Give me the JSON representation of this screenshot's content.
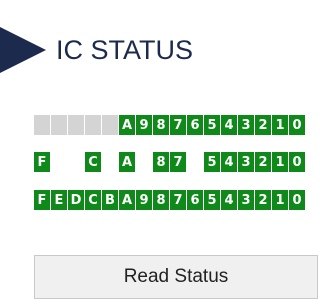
{
  "header": {
    "title": "IC STATUS"
  },
  "rows": [
    {
      "bits": [
        {
          "label": "",
          "state": "off"
        },
        {
          "label": "",
          "state": "off"
        },
        {
          "label": "",
          "state": "off"
        },
        {
          "label": "",
          "state": "off"
        },
        {
          "label": "",
          "state": "off"
        },
        {
          "label": "A",
          "state": "on"
        },
        {
          "label": "9",
          "state": "on"
        },
        {
          "label": "8",
          "state": "on"
        },
        {
          "label": "7",
          "state": "on"
        },
        {
          "label": "6",
          "state": "on"
        },
        {
          "label": "5",
          "state": "on"
        },
        {
          "label": "4",
          "state": "on"
        },
        {
          "label": "3",
          "state": "on"
        },
        {
          "label": "2",
          "state": "on"
        },
        {
          "label": "1",
          "state": "on"
        },
        {
          "label": "0",
          "state": "on"
        }
      ]
    },
    {
      "bits": [
        {
          "label": "F",
          "state": "on"
        },
        {
          "label": "",
          "state": "blank"
        },
        {
          "label": "",
          "state": "blank"
        },
        {
          "label": "C",
          "state": "on"
        },
        {
          "label": "",
          "state": "blank"
        },
        {
          "label": "A",
          "state": "on"
        },
        {
          "label": "",
          "state": "blank"
        },
        {
          "label": "8",
          "state": "on"
        },
        {
          "label": "7",
          "state": "on"
        },
        {
          "label": "",
          "state": "blank"
        },
        {
          "label": "5",
          "state": "on"
        },
        {
          "label": "4",
          "state": "on"
        },
        {
          "label": "3",
          "state": "on"
        },
        {
          "label": "2",
          "state": "on"
        },
        {
          "label": "1",
          "state": "on"
        },
        {
          "label": "0",
          "state": "on"
        }
      ]
    },
    {
      "bits": [
        {
          "label": "F",
          "state": "on"
        },
        {
          "label": "E",
          "state": "on"
        },
        {
          "label": "D",
          "state": "on"
        },
        {
          "label": "C",
          "state": "on"
        },
        {
          "label": "B",
          "state": "on"
        },
        {
          "label": "A",
          "state": "on"
        },
        {
          "label": "9",
          "state": "on"
        },
        {
          "label": "8",
          "state": "on"
        },
        {
          "label": "7",
          "state": "on"
        },
        {
          "label": "6",
          "state": "on"
        },
        {
          "label": "5",
          "state": "on"
        },
        {
          "label": "4",
          "state": "on"
        },
        {
          "label": "3",
          "state": "on"
        },
        {
          "label": "2",
          "state": "on"
        },
        {
          "label": "1",
          "state": "on"
        },
        {
          "label": "0",
          "state": "on"
        }
      ]
    }
  ],
  "actions": {
    "read_status_label": "Read Status"
  },
  "colors": {
    "bit_on": "#0f8a1a",
    "bit_off": "#d4d4d4",
    "header": "#1c2a4e"
  }
}
